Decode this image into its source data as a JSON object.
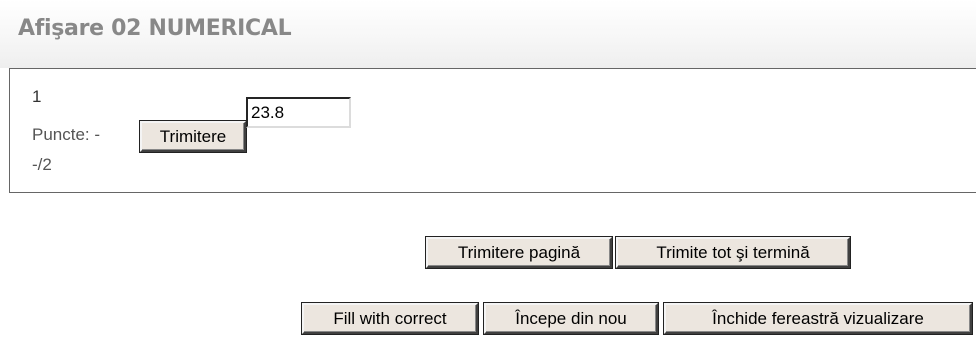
{
  "header": {
    "title": "Afişare 02 NUMERICAL"
  },
  "question": {
    "number": "1",
    "grade_label": "Puncte: -",
    "grade_max": "-/2",
    "submit_label": "Trimitere",
    "answer_value": "23.8"
  },
  "actions": {
    "submit_page_label": "Trimitere pagină",
    "submit_all_label": "Trimite tot şi termină",
    "fill_correct_label": "Fill with correct",
    "start_again_label": "Începe din nou",
    "close_preview_label": "Închide fereastră vizualizare"
  }
}
